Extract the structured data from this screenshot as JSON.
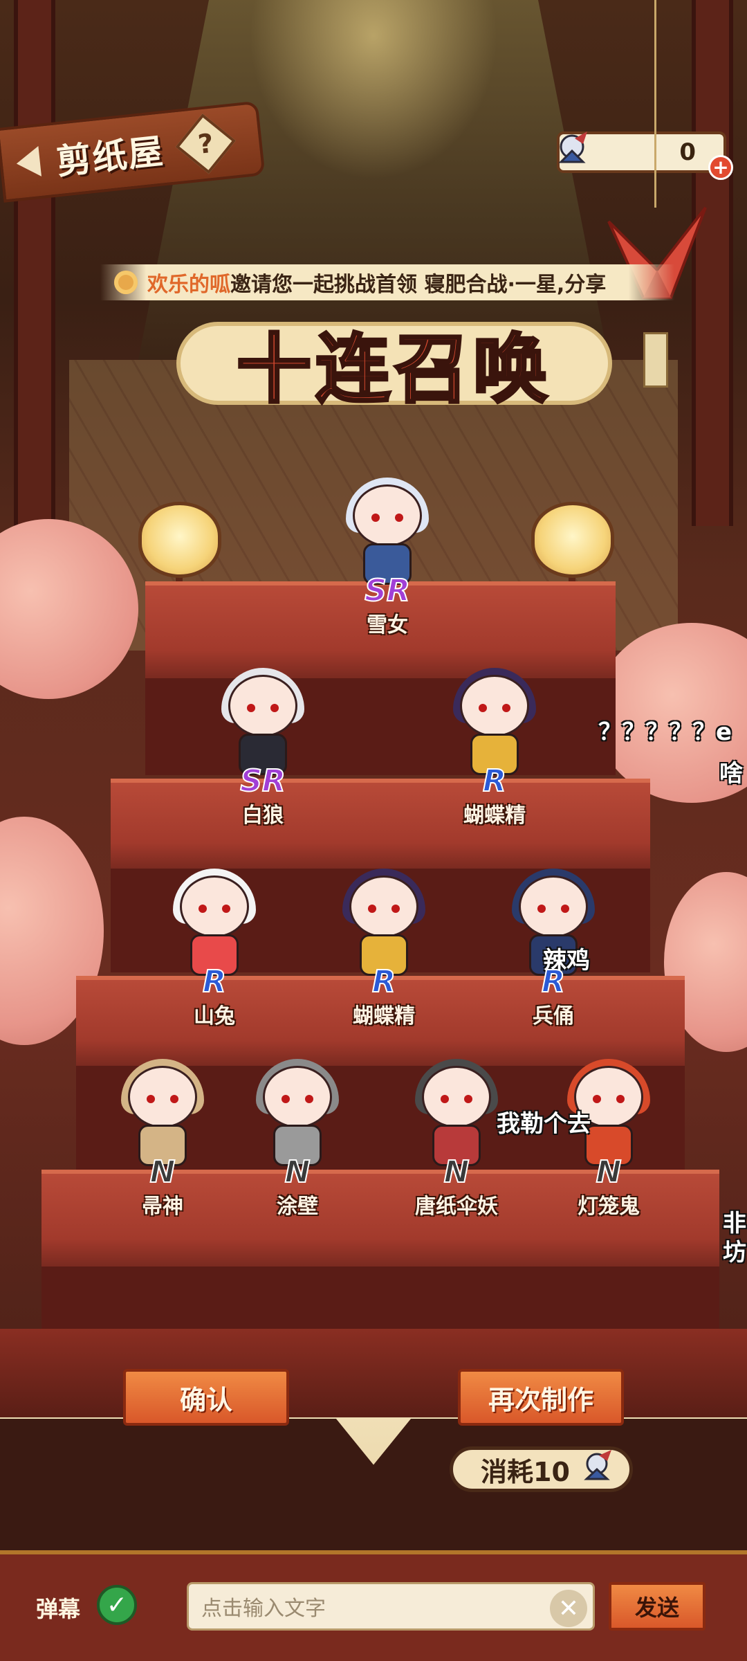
{
  "header": {
    "title": "剪纸屋",
    "help_label": "?"
  },
  "currency": {
    "amount": "0",
    "plus_label": "+"
  },
  "broadcast": {
    "user": "欢乐的呱",
    "message": "邀请您一起挑战首领 寝肥合战·一星,分享"
  },
  "summon_title": "十连召唤",
  "characters": [
    {
      "name": "雪女",
      "rarity": "SR",
      "hair": "#dfe6f4",
      "body": "#3a5a9a"
    },
    {
      "name": "白狼",
      "rarity": "SR",
      "hair": "#e6e6ea",
      "body": "#2a2a34"
    },
    {
      "name": "蝴蝶精",
      "rarity": "R",
      "hair": "#3a2a5a",
      "body": "#e6b23a"
    },
    {
      "name": "山兔",
      "rarity": "R",
      "hair": "#f4f4f4",
      "body": "#e84a4a"
    },
    {
      "name": "蝴蝶精",
      "rarity": "R",
      "hair": "#3a2a5a",
      "body": "#e6b23a"
    },
    {
      "name": "兵俑",
      "rarity": "R",
      "hair": "#2a3a6a",
      "body": "#2a3a6a"
    },
    {
      "name": "帚神",
      "rarity": "N",
      "hair": "#d4b486",
      "body": "#d4b486"
    },
    {
      "name": "涂壁",
      "rarity": "N",
      "hair": "#8a8a8a",
      "body": "#9a9a9a"
    },
    {
      "name": "唐纸伞妖",
      "rarity": "N",
      "hair": "#4a4a4a",
      "body": "#b83a3a"
    },
    {
      "name": "灯笼鬼",
      "rarity": "N",
      "hair": "#d84a2a",
      "body": "#d84a2a"
    }
  ],
  "danmu": [
    {
      "text": "？？？？？e"
    },
    {
      "text": "啥"
    },
    {
      "text": "辣鸡"
    },
    {
      "text": "我勒个去"
    },
    {
      "text": "非"
    },
    {
      "text": "坊"
    }
  ],
  "buttons": {
    "confirm": "确认",
    "again": "再次制作"
  },
  "cost": {
    "label": "消耗10"
  },
  "chat": {
    "danmu_label": "弹幕",
    "placeholder": "点击输入文字",
    "send": "发送",
    "clear": "✕",
    "check": "✓"
  },
  "colors": {
    "accent": "#d9582a",
    "sr": "#a13fd6",
    "r": "#2a5ad6",
    "n": "#3a3a3a"
  }
}
